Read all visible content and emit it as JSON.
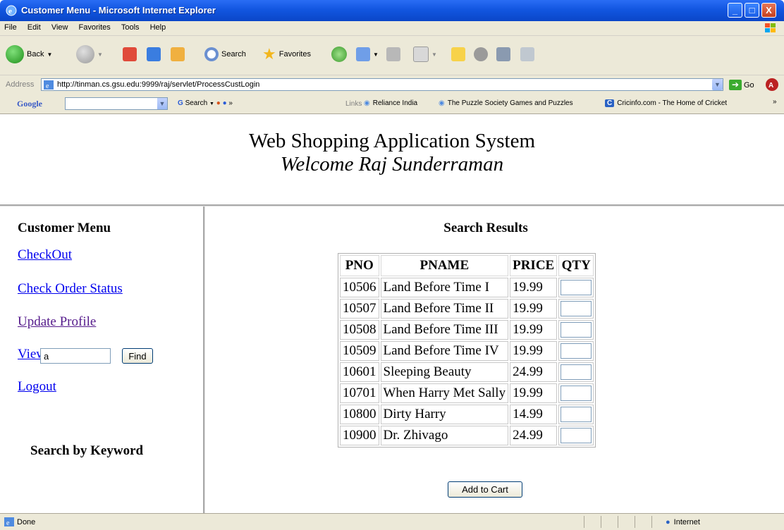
{
  "window": {
    "title": "Customer Menu - Microsoft Internet Explorer",
    "min_glyph": "_",
    "max_glyph": "□",
    "close_glyph": "X"
  },
  "menu": [
    "File",
    "Edit",
    "View",
    "Favorites",
    "Tools",
    "Help"
  ],
  "toolbar": {
    "back_label": "Back",
    "search_label": "Search",
    "favorites_label": "Favorites"
  },
  "address": {
    "label": "Address",
    "url": "http://tinman.cs.gsu.edu:9999/raj/servlet/ProcessCustLogin",
    "go_label": "Go"
  },
  "google_bar": {
    "logo": "Google",
    "search_label": "Search",
    "more": "»"
  },
  "links": {
    "label": "Links",
    "items": [
      "Reliance India",
      "The Puzzle Society Games and Puzzles",
      "Cricinfo.com - The Home of Cricket"
    ],
    "more": "»"
  },
  "page": {
    "title": "Web Shopping Application System",
    "welcome": "Welcome Raj Sunderraman"
  },
  "sidebar": {
    "heading": "Customer Menu",
    "links": [
      "CheckOut",
      "Check Order Status",
      "Update Profile",
      "View/Edit Cart",
      "Logout"
    ],
    "search_heading": "Search by Keyword",
    "search_value": "a",
    "find_label": "Find"
  },
  "results": {
    "heading": "Search Results",
    "columns": [
      "PNO",
      "PNAME",
      "PRICE",
      "QTY"
    ],
    "rows": [
      {
        "pno": "10506",
        "pname": "Land Before Time I",
        "price": "19.99"
      },
      {
        "pno": "10507",
        "pname": "Land Before Time II",
        "price": "19.99"
      },
      {
        "pno": "10508",
        "pname": "Land Before Time III",
        "price": "19.99"
      },
      {
        "pno": "10509",
        "pname": "Land Before Time IV",
        "price": "19.99"
      },
      {
        "pno": "10601",
        "pname": "Sleeping Beauty",
        "price": "24.99"
      },
      {
        "pno": "10701",
        "pname": "When Harry Met Sally",
        "price": "19.99"
      },
      {
        "pno": "10800",
        "pname": "Dirty Harry",
        "price": "14.99"
      },
      {
        "pno": "10900",
        "pname": "Dr. Zhivago",
        "price": "24.99"
      }
    ],
    "add_button": "Add to Cart"
  },
  "status": {
    "text": "Done",
    "zone": "Internet"
  },
  "colors": {
    "titlebar": "#0a46c8",
    "chrome": "#ece9d8",
    "link": "#0000ee",
    "visited_link": "#551a8b"
  }
}
